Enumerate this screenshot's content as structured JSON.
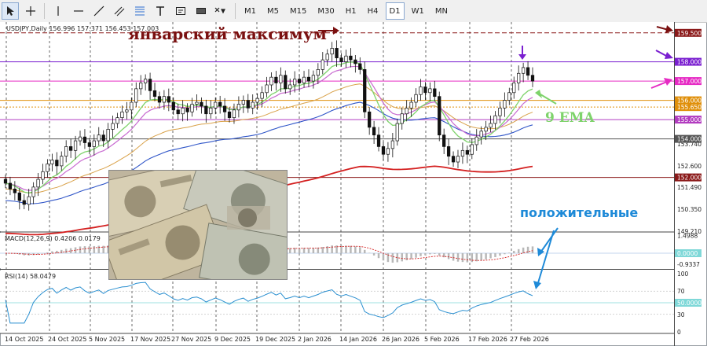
{
  "toolbar": {
    "timeframes": [
      "M1",
      "M5",
      "M15",
      "M30",
      "H1",
      "H4",
      "D1",
      "W1",
      "MN"
    ],
    "active_timeframe": "D1"
  },
  "chart_info": {
    "header": "USDJPY,Daily  156.996 157.371 156.453 157.003",
    "macd_label": "MACD(12,26,9) 0.4206 0.0179",
    "rsi_label": "RSI(14) 58.0479"
  },
  "annotations": {
    "january_max": "январский максимум",
    "ema_label": "9 EMA",
    "positive": "положительные"
  },
  "colors": {
    "candle": "#111111",
    "ema9": "#7ed36b",
    "ma_magenta": "#c86ad0",
    "ma_orange": "#d9a24a",
    "ma_blue": "#2f55c8",
    "ma_red": "#d42020",
    "level_maroon": "#8b1a1a",
    "level_purple": "#7a1fd0",
    "level_magenta": "#e62bc4",
    "level_orange": "#e0900b",
    "level_violet": "#b23cc0",
    "level_gray": "#555555",
    "annotation_dark_red": "#7a1010",
    "annotation_green": "#7ed36b",
    "annotation_blue": "#1e8ad8",
    "rsi_line": "#2a8fd0",
    "macd_signal": "#d42020"
  },
  "chart_data": [
    {
      "type": "line",
      "panel": "price",
      "ylim": [
        149.21,
        159.9
      ],
      "price_ticks": [
        "159.500",
        "158.000",
        "157.000",
        "156.000",
        "155.650",
        "155.000",
        "154.000",
        "153.740",
        "152.600",
        "152.000",
        "151.490",
        "150.350",
        "149.210"
      ],
      "level_lines": [
        {
          "price": 159.5,
          "label": "159.500",
          "color": "#8b1a1a",
          "style": "dashed"
        },
        {
          "price": 158.0,
          "label": "158.000",
          "color": "#7a1fd0",
          "style": "solid"
        },
        {
          "price": 157.0,
          "label": "157.000",
          "color": "#e62bc4",
          "style": "solid"
        },
        {
          "price": 156.0,
          "label": "156.000",
          "color": "#e0900b",
          "style": "solid"
        },
        {
          "price": 155.65,
          "label": "155.650",
          "color": "#e0900b",
          "style": "dotted"
        },
        {
          "price": 155.0,
          "label": "155.000",
          "color": "#b23cc0",
          "style": "solid"
        },
        {
          "price": 154.0,
          "label": "154.000",
          "color": "#555555",
          "style": "solid"
        },
        {
          "price": 152.0,
          "label": "152.000",
          "color": "#8b1a1a",
          "style": "solid"
        }
      ],
      "date_labels": [
        "14 Oct 2025",
        "24 Oct 2025",
        "5 Nov 2025",
        "17 Nov 2025",
        "27 Nov 2025",
        "9 Dec 2025",
        "19 Dec 2025",
        "2 Jan 2026",
        "14 Jan 2026",
        "26 Jan 2026",
        "5 Feb 2026",
        "17 Feb 2026",
        "27 Feb 2026"
      ],
      "close": [
        151.7,
        151.4,
        151.2,
        150.8,
        150.6,
        151.0,
        151.5,
        151.9,
        152.3,
        152.7,
        152.9,
        152.6,
        153.1,
        153.6,
        153.4,
        153.9,
        154.1,
        153.8,
        153.6,
        153.9,
        154.2,
        153.9,
        154.5,
        154.8,
        155.1,
        155.4,
        155.5,
        155.9,
        156.6,
        156.9,
        157.1,
        156.5,
        156.2,
        155.9,
        156.2,
        155.9,
        155.5,
        155.3,
        155.6,
        155.4,
        155.8,
        155.9,
        155.7,
        155.3,
        155.6,
        155.9,
        155.7,
        155.4,
        155.1,
        155.5,
        155.8,
        156.0,
        155.6,
        155.9,
        156.1,
        156.4,
        156.8,
        157.2,
        156.9,
        157.3,
        156.6,
        156.8,
        157.1,
        156.9,
        157.2,
        157.0,
        157.3,
        157.6,
        158.1,
        158.4,
        158.7,
        158.2,
        158.0,
        158.3,
        158.1,
        157.9,
        157.6,
        155.4,
        154.6,
        154.2,
        153.6,
        153.2,
        153.5,
        153.9,
        154.8,
        155.3,
        155.6,
        155.9,
        156.3,
        156.7,
        156.4,
        156.6,
        156.2,
        154.2,
        153.6,
        153.1,
        152.8,
        153.1,
        153.4,
        153.2,
        153.7,
        154.1,
        154.4,
        154.6,
        154.8,
        155.2,
        155.6,
        156.0,
        156.4,
        156.9,
        157.4,
        157.7,
        157.3,
        157.0
      ],
      "series": [
        {
          "name": "9 EMA",
          "color": "#7ed36b"
        }
      ]
    },
    {
      "type": "bar",
      "panel": "macd",
      "ticks": [
        "1.4988",
        "0.0000",
        "-0.9337"
      ],
      "ylim": [
        -1.2,
        1.6
      ]
    },
    {
      "type": "line",
      "panel": "rsi",
      "ticks": [
        "100",
        "70",
        "50.0000",
        "30",
        "0"
      ],
      "ylim": [
        0,
        100
      ],
      "level": 50
    }
  ]
}
